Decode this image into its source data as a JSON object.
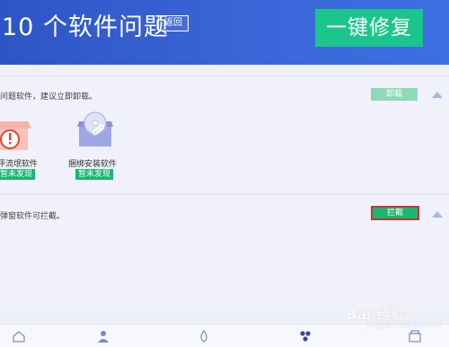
{
  "header": {
    "title": "10 个软件问题",
    "back_label": "返回",
    "fix_label": "一键修复"
  },
  "section_uninstall": {
    "description": "问题软件，建议立即卸载。",
    "button_label": "卸载",
    "items": [
      {
        "name": "评流氓软件",
        "status": "暂未发现",
        "icon": "warning-box-icon"
      },
      {
        "name": "捆绑安装软件",
        "status": "暂未发现",
        "icon": "bundle-disc-icon"
      }
    ]
  },
  "section_block": {
    "description": "弹窗软件可拦截。",
    "button_label": "拦截"
  },
  "bottom_nav": {
    "items": [
      {
        "label": "",
        "icon": "home-icon"
      },
      {
        "label": "",
        "icon": "person-icon"
      },
      {
        "label": "",
        "icon": "drop-icon"
      },
      {
        "label": "",
        "icon": "cluster-icon"
      },
      {
        "label": "",
        "icon": "box-icon"
      }
    ]
  },
  "watermark": {
    "brand": "Bai 经验",
    "url": "jingyan.baidu.com"
  },
  "colors": {
    "header_blue": "#3a66d8",
    "accent_green": "#1cc58b",
    "status_green": "#16b86e",
    "uninstall_disabled": "#8ed9b6",
    "highlight_red": "#c4363a"
  }
}
